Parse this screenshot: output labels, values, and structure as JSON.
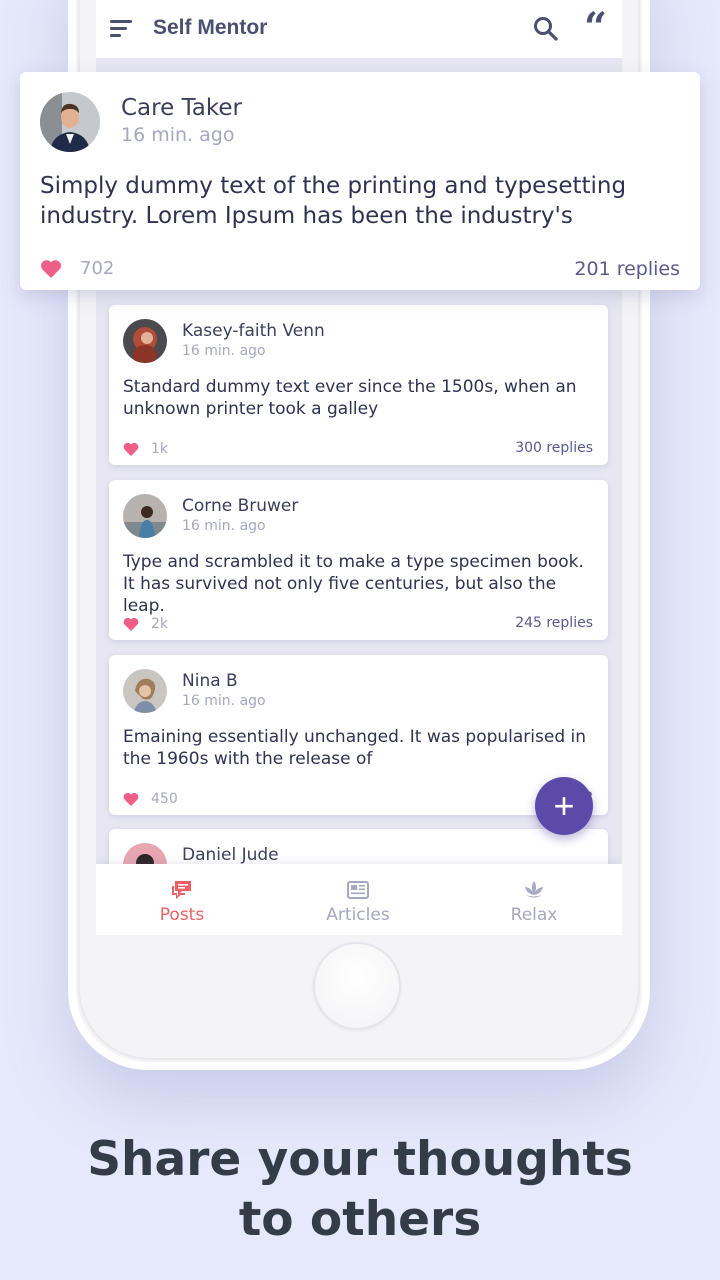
{
  "app": {
    "title": "Self Mentor"
  },
  "featured_post": {
    "author": "Care Taker",
    "time": "16 min. ago",
    "text": "Simply dummy text of the printing and typesetting industry. Lorem Ipsum has been the industry's",
    "likes": "702",
    "replies": "201 replies"
  },
  "posts": [
    {
      "author": "Kasey-faith Venn",
      "time": "16 min. ago",
      "text": "Standard dummy text ever since the 1500s, when an unknown printer took a galley",
      "likes": "1k",
      "replies": "300 replies"
    },
    {
      "author": "Corne Bruwer",
      "time": "16 min. ago",
      "text": "Type and scrambled it to make a type specimen book. It has survived not only five centuries, but also the leap.",
      "likes": "2k",
      "replies": "245 replies"
    },
    {
      "author": "Nina B",
      "time": "16 min. ago",
      "text": "Emaining essentially unchanged. It was popularised in the 1960s with the release of",
      "likes": "450",
      "replies": "108"
    },
    {
      "author": "Daniel Jude",
      "time": "",
      "text": "",
      "likes": "",
      "replies": ""
    }
  ],
  "fab": {
    "label": "+"
  },
  "nav": {
    "items": [
      {
        "label": "Posts",
        "icon": "chat-bubbles-icon",
        "active": true
      },
      {
        "label": "Articles",
        "icon": "newspaper-icon",
        "active": false
      },
      {
        "label": "Relax",
        "icon": "lotus-icon",
        "active": false
      }
    ]
  },
  "caption": {
    "line1": "Share your thoughts",
    "line2": "to others"
  },
  "colors": {
    "background": "#e6e8fb",
    "accent": "#5b4aa8",
    "active_nav": "#ee5f63",
    "heart": "#ee5f87",
    "muted_text": "#a5a8bf"
  }
}
